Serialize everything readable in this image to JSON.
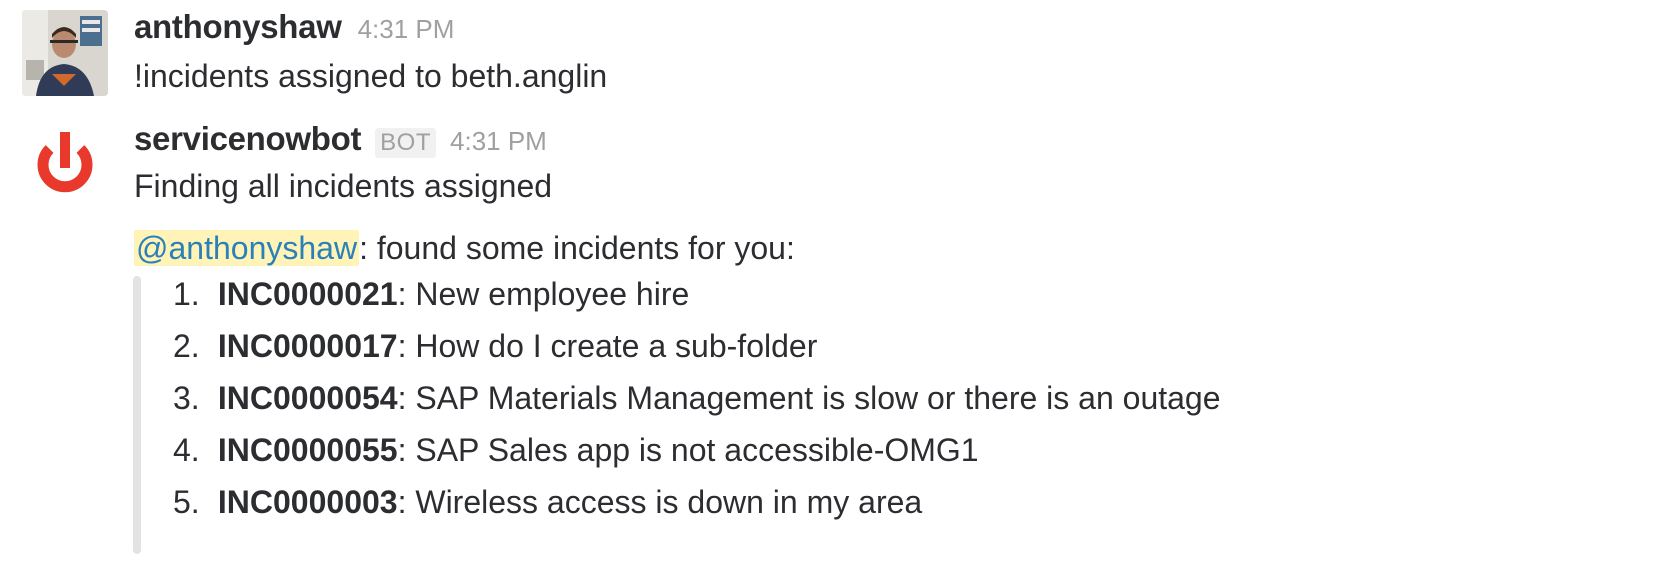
{
  "messages": [
    {
      "author": "anthonyshaw",
      "timestamp": "4:31 PM",
      "text": "!incidents assigned to beth.anglin",
      "avatar_icon": "user-photo-avatar"
    },
    {
      "author": "servicenowbot",
      "bot_tag": "BOT",
      "timestamp": "4:31 PM",
      "avatar_icon": "power-icon",
      "text": "Finding all incidents assigned",
      "found_message": {
        "mention": "@anthonyshaw",
        "text": ": found some incidents for you:"
      },
      "incidents": [
        {
          "num": "1.",
          "id": "INC0000021",
          "desc": ": New employee hire"
        },
        {
          "num": "2.",
          "id": "INC0000017",
          "desc": ": How do I create a sub-folder"
        },
        {
          "num": "3.",
          "id": "INC0000054",
          "desc": ": SAP Materials Management is slow or there is an outage"
        },
        {
          "num": "4.",
          "id": "INC0000055",
          "desc": ": SAP Sales app is not accessible-OMG1"
        },
        {
          "num": "5.",
          "id": "INC0000003",
          "desc": ": Wireless access is down in my area"
        }
      ]
    }
  ],
  "colors": {
    "power_icon": "#e8392c",
    "mention_bg": "#fff3b8",
    "mention_text": "#2a80b9",
    "attachment_bar": "#e3e3e3",
    "timestamp": "#a0a0a2"
  }
}
